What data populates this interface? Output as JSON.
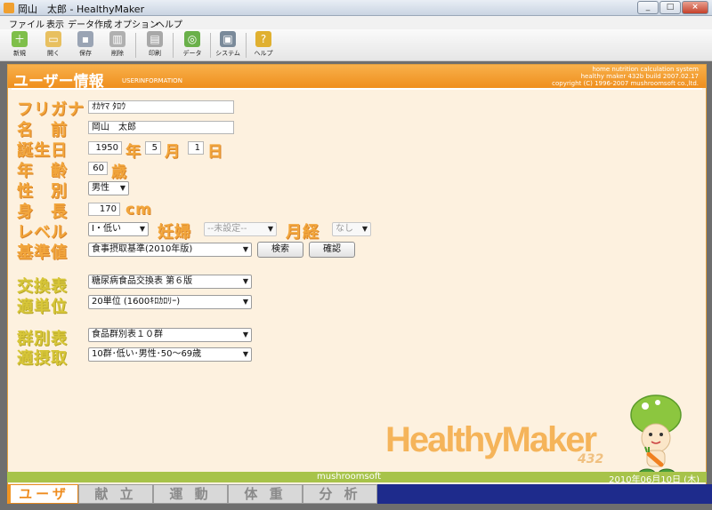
{
  "window": {
    "title": "岡山　太郎 - HealthyMaker",
    "min": "_",
    "max": "□",
    "close": "×"
  },
  "menu": [
    "ファイル",
    "表示",
    "データ作成",
    "オプション",
    "ヘルプ"
  ],
  "toolbar": {
    "new": "新規",
    "open": "開く",
    "save": "保存",
    "delete": "削除",
    "print": "印刷",
    "data": "データ",
    "system": "システム",
    "help": "ヘルプ"
  },
  "header": {
    "title": "ユーザー情報",
    "subtitle": "USERINFORMATION",
    "info1": "home nutrition calculation system",
    "info2": "healthy maker 432b build 2007.02.17",
    "info3": "copyright (C) 1996-2007 mushroomsoft co.,ltd."
  },
  "labels": {
    "furigana": "フリガナ",
    "name": "名　前",
    "birthday": "誕生日",
    "age": "年　齢",
    "sex": "性　別",
    "height": "身　長",
    "level": "レベル",
    "pregnancy": "妊婦",
    "menses": "月経",
    "standard": "基準値",
    "exchange": "交換表",
    "unit": "適単位",
    "group": "群別表",
    "intake": "適摂取"
  },
  "units": {
    "year": "年",
    "month": "月",
    "day": "日",
    "age": "歳",
    "cm": "cm"
  },
  "form": {
    "furigana": "ｵｶﾔﾏ ﾀﾛｳ",
    "name": "岡山　太郎",
    "birth_year": "1950",
    "birth_month": "5",
    "birth_day": "1",
    "age": "60",
    "sex": "男性",
    "height": "170",
    "level": "Ⅰ・低い",
    "pregnancy": "--未設定--",
    "menses": "なし",
    "standard": "食事摂取基準(2010年版)",
    "exchange": "糖尿病食品交換表 第６版",
    "unit": "20単位 (1600ｷﾛｶﾛﾘｰ)",
    "group": "食品群別表１０群",
    "intake": "10群･低い･男性･50～69歳"
  },
  "buttons": {
    "search": "検索",
    "confirm": "確認"
  },
  "logo": {
    "text": "HealthyMaker",
    "version": "432"
  },
  "status": {
    "left": "mushroomsoft",
    "right": "2010年06月10日 (木)"
  },
  "tabs": [
    "ユーザー",
    "献 立",
    "運 動",
    "体 重",
    "分 析"
  ],
  "colors": {
    "accent": "#f09422",
    "panel": "#fdf1df",
    "status": "#a7c34a",
    "label_green": "#d7c638"
  }
}
